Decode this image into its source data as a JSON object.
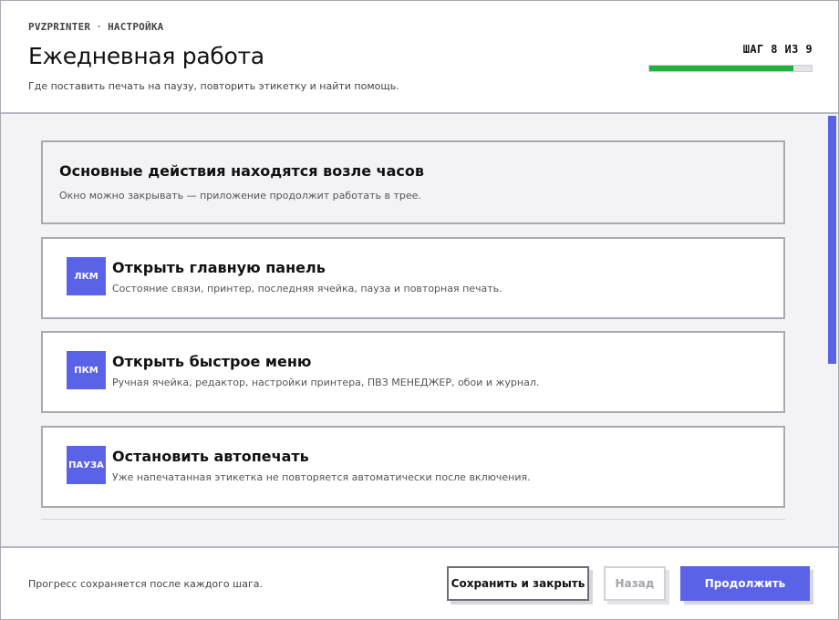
{
  "header": {
    "breadcrumb": [
      "PVZPRINTER",
      "·",
      "НАСТРОЙКА"
    ],
    "title": "Ежедневная работа",
    "subtitle": "Где поставить печать на паузу, повторить этикетку и найти помощь.",
    "step_label": "ШАГ 8 ИЗ 9",
    "progress": 0.89,
    "progress_color": "#1db33b"
  },
  "intro": {
    "title": "Основные действия находятся возле часов",
    "text": "Окно можно закрывать — приложение продолжит работать в трее."
  },
  "actions": [
    {
      "badge": "ЛКМ",
      "title": "Открыть главную панель",
      "text": "Состояние связи, принтер, последняя ячейка, пауза и повторная печать."
    },
    {
      "badge": "ПКМ",
      "title": "Открыть быстрое меню",
      "text": "Ручная ячейка, редактор, настройки принтера, ПВЗ МЕНЕДЖЕР, обои и журнал."
    },
    {
      "badge": "ПАУЗА",
      "title": "Остановить автопечать",
      "text": "Уже напечатанная этикетка не повторяется автоматически после включения."
    }
  ],
  "footer": {
    "note": "Прогресс сохраняется после каждого шага.",
    "save_label": "Сохранить и закрыть",
    "back_label": "Назад",
    "next_label": "Продолжить"
  },
  "colors": {
    "accent": "#5a62e8",
    "progress": "#1db33b"
  }
}
